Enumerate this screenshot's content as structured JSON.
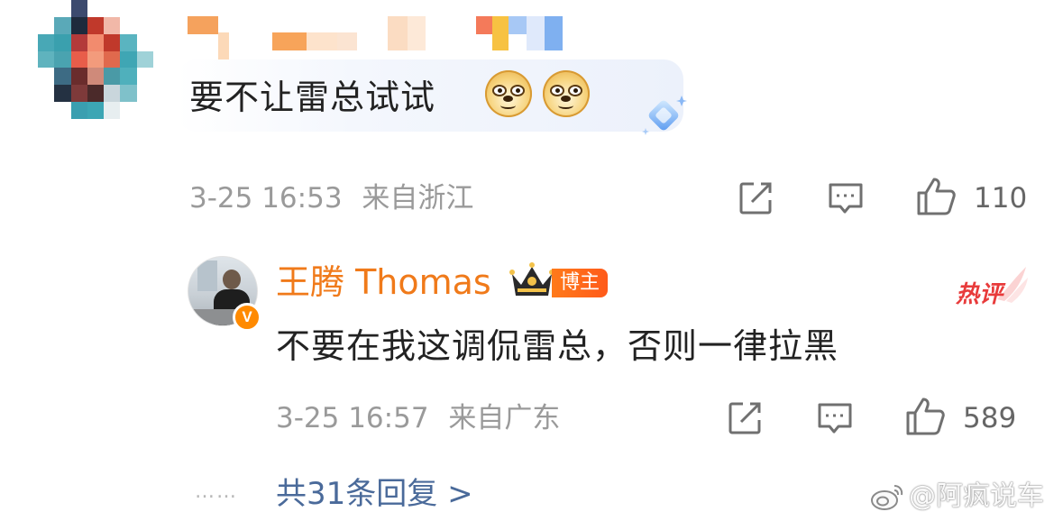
{
  "top_comment": {
    "text": "要不让雷总试试",
    "emojis": [
      "doge-icon",
      "doge-icon"
    ],
    "time": "3-25 16:53",
    "location": "来自浙江",
    "like_count": "110"
  },
  "reply": {
    "author": "王腾 Thomas",
    "badge": "博主",
    "hot_label": "热评",
    "text": "不要在我这调侃雷总，否则一律拉黑",
    "time": "3-25 16:57",
    "location": "来自广东",
    "like_count": "589"
  },
  "more_replies": {
    "dots": "……",
    "label": "共31条回复 >"
  },
  "watermark": {
    "text": "@阿疯说车"
  },
  "colors": {
    "author_name": "#f07a1a",
    "link_blue": "#4a6a9a",
    "meta_gray": "#9a9a9a",
    "hot_red": "#e83b3b"
  }
}
